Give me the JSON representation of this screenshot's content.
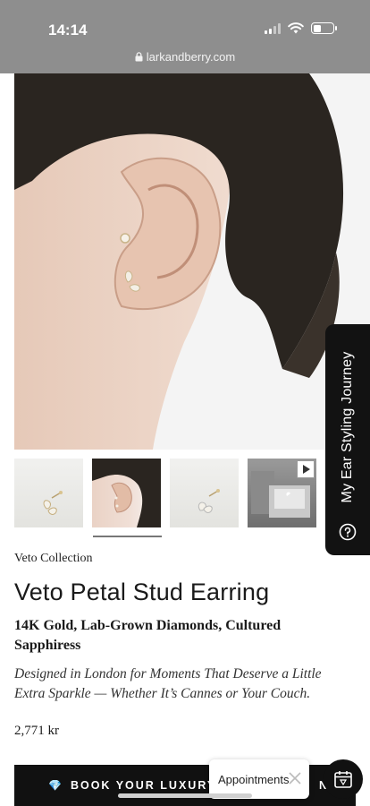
{
  "status_bar": {
    "time": "14:14"
  },
  "browser": {
    "url": "larkandberry.com"
  },
  "side_tab": {
    "label": "My Ear Styling Journey"
  },
  "product": {
    "collection": "Veto Collection",
    "title": "Veto Petal Stud Earring",
    "materials": "14K Gold, Lab-Grown Diamonds, Cultured Sapphiress",
    "tagline": "Designed in London for Moments That Deserve a Little Extra Sparkle — Whether It’s Cannes or Your Couch.",
    "price": "2,771 kr"
  },
  "thumbnails": [
    {
      "kind": "product-photo",
      "selected": false
    },
    {
      "kind": "model-ear-photo",
      "selected": true
    },
    {
      "kind": "product-photo",
      "selected": false
    },
    {
      "kind": "video",
      "selected": false
    }
  ],
  "cta": {
    "label": "BOOK YOUR LUXURY EAR",
    "label_tail": "N"
  },
  "appointments": {
    "label": "Appointments"
  },
  "colors": {
    "accent_dark": "#111111",
    "gem": "#7ec8f0",
    "skin": "#ecd6c8"
  }
}
